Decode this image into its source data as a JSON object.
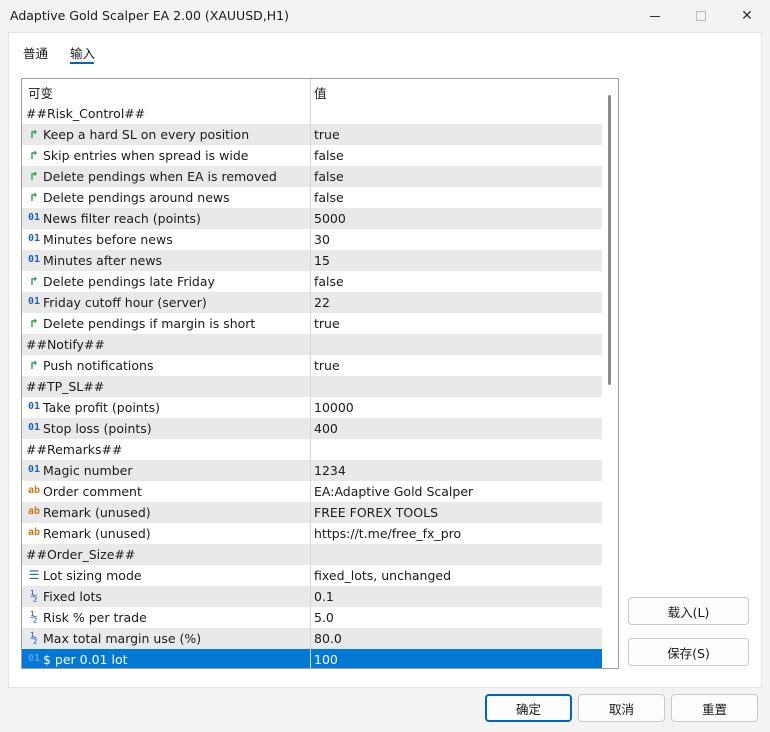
{
  "window": {
    "title": "Adaptive Gold Scalper EA 2.00 (XAUUSD,H1)"
  },
  "tabs": {
    "general": "普通",
    "inputs": "输入"
  },
  "grid": {
    "col_variable": "可变",
    "col_value": "值",
    "rows": [
      {
        "kind": "header",
        "label": "##Risk_Control##",
        "value": ""
      },
      {
        "kind": "param",
        "type": "bool",
        "label": "Keep a hard SL on every position",
        "value": "true"
      },
      {
        "kind": "param",
        "type": "bool",
        "label": "Skip entries when spread is wide",
        "value": "false"
      },
      {
        "kind": "param",
        "type": "bool",
        "label": "Delete pendings when EA is removed",
        "value": "false"
      },
      {
        "kind": "param",
        "type": "bool",
        "label": "Delete pendings around news",
        "value": "false"
      },
      {
        "kind": "param",
        "type": "int",
        "label": "News filter reach (points)",
        "value": "5000"
      },
      {
        "kind": "param",
        "type": "int",
        "label": "Minutes before news",
        "value": "30"
      },
      {
        "kind": "param",
        "type": "int",
        "label": "Minutes after news",
        "value": "15"
      },
      {
        "kind": "param",
        "type": "bool",
        "label": "Delete pendings late Friday",
        "value": "false"
      },
      {
        "kind": "param",
        "type": "int",
        "label": "Friday cutoff hour (server)",
        "value": "22"
      },
      {
        "kind": "param",
        "type": "bool",
        "label": "Delete pendings if margin is short",
        "value": "true"
      },
      {
        "kind": "header",
        "label": "##Notify##",
        "value": ""
      },
      {
        "kind": "param",
        "type": "bool",
        "label": "Push notifications",
        "value": "true"
      },
      {
        "kind": "header",
        "label": "##TP_SL##",
        "value": ""
      },
      {
        "kind": "param",
        "type": "int",
        "label": "Take profit (points)",
        "value": "10000"
      },
      {
        "kind": "param",
        "type": "int",
        "label": "Stop loss (points)",
        "value": "400"
      },
      {
        "kind": "header",
        "label": "##Remarks##",
        "value": ""
      },
      {
        "kind": "param",
        "type": "int",
        "label": "Magic number",
        "value": "1234"
      },
      {
        "kind": "param",
        "type": "str",
        "label": "Order comment",
        "value": "EA:Adaptive Gold Scalper"
      },
      {
        "kind": "param",
        "type": "str",
        "label": "Remark (unused)",
        "value": "FREE FOREX TOOLS"
      },
      {
        "kind": "param",
        "type": "str",
        "label": "Remark (unused)",
        "value": "https://t.me/free_fx_pro"
      },
      {
        "kind": "header",
        "label": "##Order_Size##",
        "value": ""
      },
      {
        "kind": "param",
        "type": "enum",
        "label": "Lot sizing mode",
        "value": "fixed_lots, unchanged"
      },
      {
        "kind": "param",
        "type": "dbl",
        "label": "Fixed lots",
        "value": "0.1"
      },
      {
        "kind": "param",
        "type": "dbl",
        "label": "Risk % per trade",
        "value": "5.0"
      },
      {
        "kind": "param",
        "type": "dbl",
        "label": "Max total margin use (%)",
        "value": "80.0"
      },
      {
        "kind": "param",
        "type": "int",
        "label": "$ per 0.01 lot",
        "value": "100",
        "selected": true
      }
    ]
  },
  "icons": {
    "bool": "↱",
    "int": "01",
    "str": "ab",
    "dbl": "½",
    "enum": "☰"
  },
  "buttons": {
    "load": "载入(L)",
    "save": "保存(S)",
    "ok": "确定",
    "cancel": "取消",
    "reset": "重置"
  },
  "colors": {
    "accent": "#0078d4",
    "row_alt": "#e9e9e9"
  }
}
